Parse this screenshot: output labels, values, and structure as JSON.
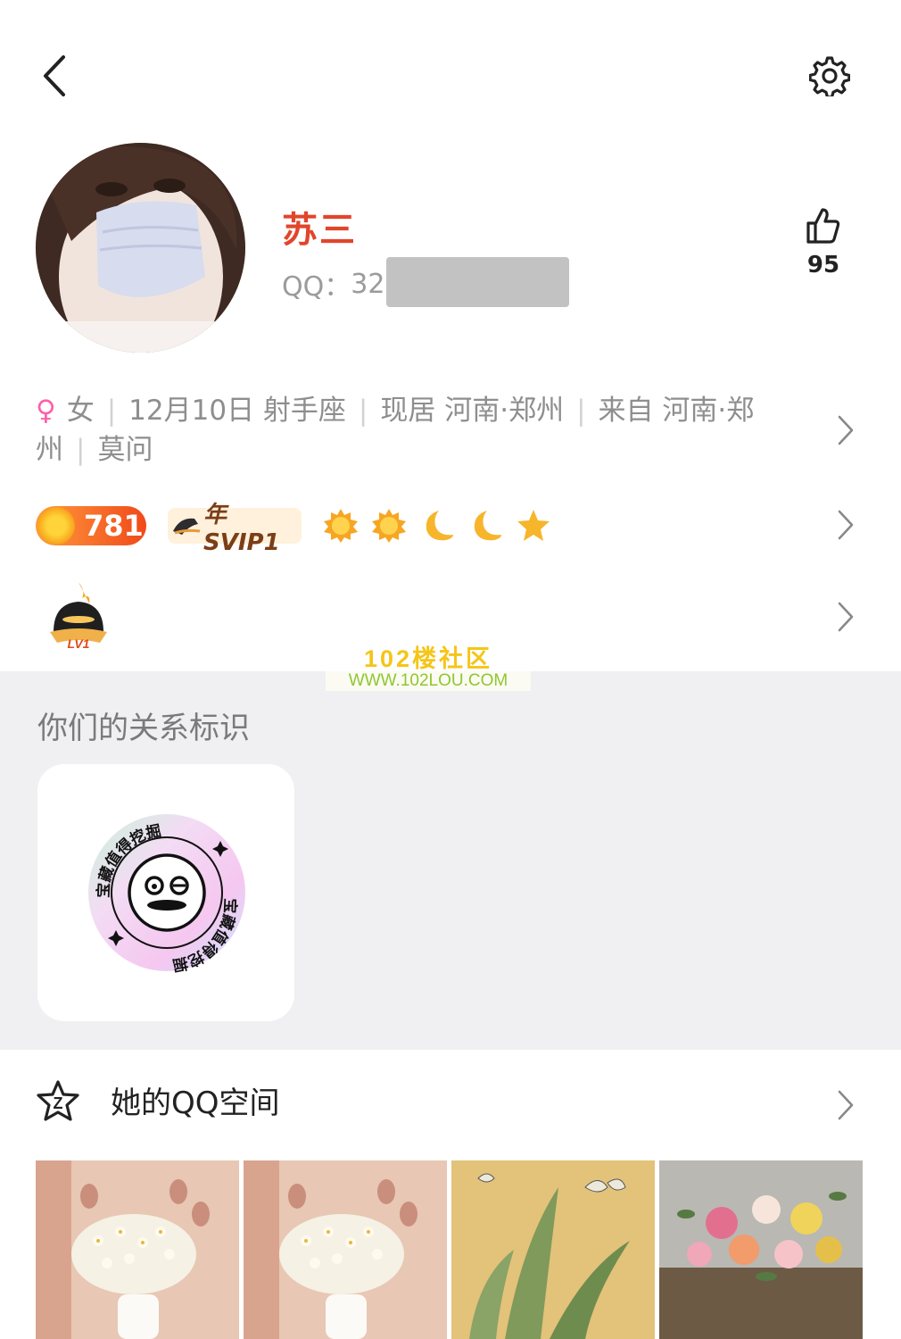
{
  "header": {
    "back_icon": "chevron-left-icon",
    "settings_icon": "gear-icon"
  },
  "profile": {
    "name": "苏三",
    "qq_label": "QQ：",
    "qq_visible": "32",
    "like_count": "95"
  },
  "info": {
    "gender_symbol": "♀",
    "gender": "女",
    "birthday": "12月10日 射手座",
    "current_city": "现居 河南·郑州",
    "hometown": "来自 河南·郑州",
    "signature": "莫问"
  },
  "badges": {
    "level_value": "781",
    "svip_label": "年SVIP1",
    "level_icons": [
      "sun-icon",
      "sun-icon",
      "moon-icon",
      "moon-icon",
      "star-icon"
    ]
  },
  "lv_badge": {
    "label": "LV1"
  },
  "watermark": {
    "line1": "102楼社区",
    "line2": "WWW.102LOU.COM"
  },
  "relationship": {
    "title": "你们的关系标识",
    "badge_text": "宝藏值得挖掘"
  },
  "qzone": {
    "title": "她的QQ空间",
    "photos": [
      "flower-vase-photo",
      "flower-vase-photo",
      "butterfly-painting-photo",
      "rose-bouquet-photo"
    ]
  },
  "colors": {
    "name": "#e2452b",
    "section_bg": "#f0f0f2",
    "accent_orange": "#f04a1a"
  }
}
